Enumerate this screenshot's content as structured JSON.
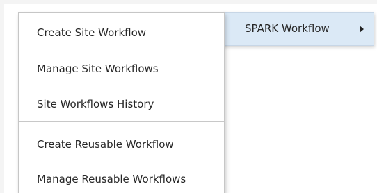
{
  "parent_menu": {
    "label": "SPARK Workflow",
    "arrow_icon": "chevron-right-icon",
    "selected_color": "#dbe9f6"
  },
  "submenu": {
    "groups": [
      {
        "items": [
          {
            "label": "Create Site Workflow"
          },
          {
            "label": "Manage Site Workflows"
          },
          {
            "label": "Site Workflows History"
          }
        ]
      },
      {
        "items": [
          {
            "label": "Create Reusable Workflow"
          },
          {
            "label": "Manage Reusable Workflows"
          }
        ]
      }
    ]
  }
}
